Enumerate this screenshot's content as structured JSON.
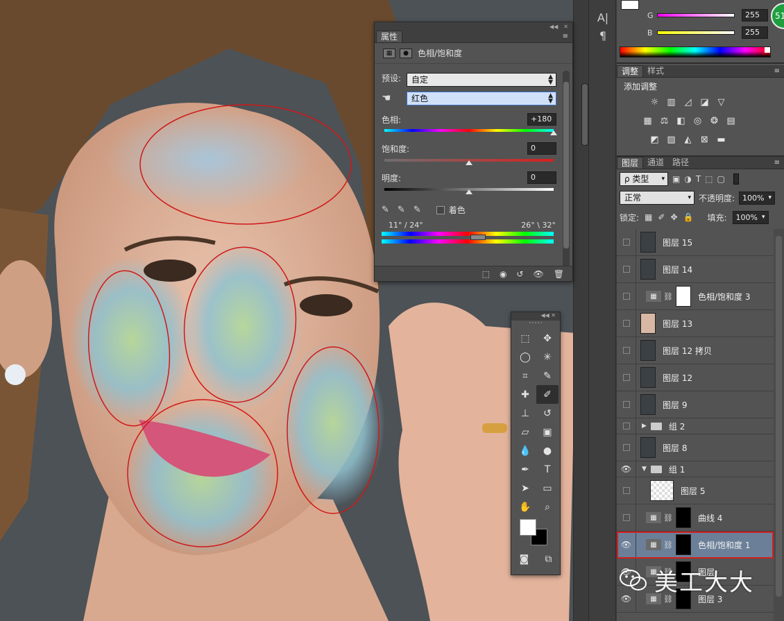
{
  "colors": {
    "accent_selected": "#6b7f98",
    "highlight_outline": "#d32020",
    "annotation_circle": "#d01818",
    "panel_bg": "#535353"
  },
  "char_tools": [
    "A|",
    "¶"
  ],
  "color_panel": {
    "channels": [
      {
        "label": "G",
        "value": "255"
      },
      {
        "label": "B",
        "value": "255"
      }
    ],
    "badge": "51"
  },
  "adjustments": {
    "tabs": [
      "调整",
      "样式"
    ],
    "title": "添加调整",
    "icon_rows": [
      [
        "sun-icon",
        "levels-icon",
        "curves-icon",
        "exposure-icon",
        "triangle-icon"
      ],
      [
        "vibrance-icon",
        "balance-icon",
        "bw-icon",
        "photo-filter-icon",
        "channel-mixer-icon",
        "grid-lookup-icon"
      ],
      [
        "invert-icon",
        "posterize-icon",
        "threshold-icon",
        "selective-color-icon",
        "gradient-map-icon"
      ]
    ]
  },
  "properties": {
    "tab": "属性",
    "header_title": "色相/饱和度",
    "preset_label": "预设:",
    "preset_value": "自定",
    "channel_value": "红色",
    "hue_label": "色相:",
    "hue_value": "+180",
    "saturation_label": "饱和度:",
    "saturation_value": "0",
    "lightness_label": "明度:",
    "lightness_value": "0",
    "hue_fraction": 1.0,
    "saturation_fraction": 0.5,
    "lightness_fraction": 0.5,
    "colorize_label": "着色",
    "range_left": "11° / 24°",
    "range_right": "26° \\ 32°"
  },
  "layers_panel": {
    "tabs": [
      "图层",
      "通道",
      "路径"
    ],
    "filter_label": "ρ 类型",
    "blend_mode": "正常",
    "opacity_label": "不透明度:",
    "opacity_value": "100%",
    "lock_label": "锁定:",
    "fill_label": "填充:",
    "fill_value": "100%",
    "layers": [
      {
        "name": "图层 15",
        "kind": "pixel",
        "visible": false
      },
      {
        "name": "图层 14",
        "kind": "pixel",
        "visible": false
      },
      {
        "name": "色相/饱和度 3",
        "kind": "adjustment",
        "visible": false
      },
      {
        "name": "图层 13",
        "kind": "pixel",
        "visible": false
      },
      {
        "name": "图层 12 拷贝",
        "kind": "pixel",
        "visible": false
      },
      {
        "name": "图层 12",
        "kind": "pixel",
        "visible": false
      },
      {
        "name": "图层 9",
        "kind": "pixel",
        "visible": false
      },
      {
        "name": "组 2",
        "kind": "group",
        "visible": false,
        "expanded": false
      },
      {
        "name": "图层 8",
        "kind": "pixel",
        "visible": false
      },
      {
        "name": "组 1",
        "kind": "group",
        "visible": true,
        "expanded": true
      },
      {
        "name": "图层 5",
        "kind": "pixel",
        "visible": false
      },
      {
        "name": "曲线 4",
        "kind": "adjustment",
        "visible": false
      },
      {
        "name": "色相/饱和度 1",
        "kind": "adjustment",
        "visible": true,
        "selected": true
      },
      {
        "name": "图层",
        "kind": "adjustment",
        "visible": true
      },
      {
        "name": "图层 3",
        "kind": "adjustment",
        "visible": true
      }
    ]
  },
  "watermark": "美工大大"
}
